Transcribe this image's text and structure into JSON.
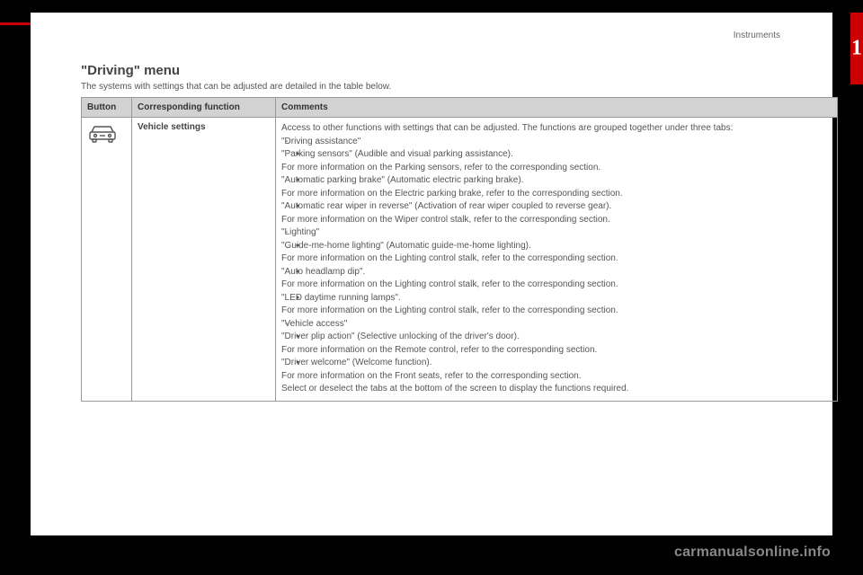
{
  "header": {
    "section_label": "Instruments",
    "chapter_number": "1"
  },
  "page": {
    "title": "\"Driving\" menu",
    "intro": "The systems with settings that can be adjusted are detailed in the table below."
  },
  "table": {
    "headers": {
      "button": "Button",
      "function": "Corresponding function",
      "comments": "Comments"
    },
    "row": {
      "function": "Vehicle settings",
      "lead": "Access to other functions with settings that can be adjusted. The functions are grouped together under three tabs:",
      "dash1": "\"Driving assistance\"",
      "b1a": "\"Parking sensors\" (Audible and visual parking assistance).",
      "b1a_sub": "For more information on the Parking sensors, refer to the corresponding section.",
      "b1b": "\"Automatic parking brake\" (Automatic electric parking brake).",
      "b1b_sub": "For more information on the Electric parking brake, refer to the corresponding section.",
      "b1c": "\"Automatic rear wiper in reverse\" (Activation of rear wiper coupled to reverse gear).",
      "b1c_sub": "For more information on the Wiper control stalk, refer to the corresponding section.",
      "dash2": "\"Lighting\"",
      "b2a": "\"Guide-me-home lighting\" (Automatic guide-me-home lighting).",
      "b2a_sub": "For more information on the Lighting control stalk, refer to the corresponding section.",
      "b2b": "\"Auto headlamp dip\".",
      "b2b_sub": "For more information on the Lighting control stalk, refer to the corresponding section.",
      "b2c": "\"LED daytime running lamps\".",
      "b2c_sub": "For more information on the Lighting control stalk, refer to the corresponding section.",
      "dash3": "\"Vehicle access\"",
      "b3a": "\"Driver plip action\" (Selective unlocking of the driver's door).",
      "b3a_sub": "For more information on the Remote control, refer to the corresponding section.",
      "b3b": "\"Driver welcome\" (Welcome function).",
      "b3b_sub": "For more information on the Front seats, refer to the corresponding section.",
      "trail": "Select or deselect the tabs at the bottom of the screen to display the functions required."
    }
  },
  "footer": {
    "watermark": "carmanualsonline.info"
  }
}
